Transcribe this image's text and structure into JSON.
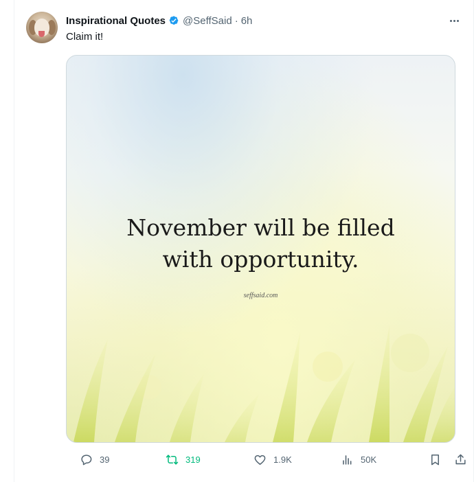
{
  "tweet": {
    "author_name": "Inspirational Quotes",
    "handle": "@SeffSaid",
    "separator": "·",
    "time": "6h",
    "text": "Claim it!",
    "verified": true
  },
  "media": {
    "quote_line1": "November will be filled",
    "quote_line2": "with opportunity.",
    "watermark": "seffsaid.com"
  },
  "actions": {
    "replies": "39",
    "retweets": "319",
    "likes": "1.9K",
    "views": "50K"
  },
  "colors": {
    "verified_blue": "#1d9bf0",
    "retweet_green": "#00ba7c",
    "secondary_text": "#536471"
  },
  "icons": [
    "more-icon",
    "reply-icon",
    "retweet-icon",
    "like-icon",
    "views-icon",
    "bookmark-icon",
    "share-icon",
    "verified-icon"
  ]
}
